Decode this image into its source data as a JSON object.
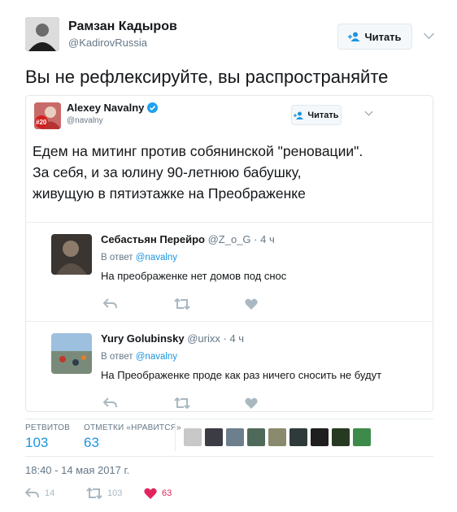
{
  "tweet": {
    "author_name": "Рамзан Кадыров",
    "author_handle": "@KadirovRussia",
    "follow_label": "Читать",
    "text": "Вы не рефлексируйте, вы распространяйте",
    "timestamp": "18:40 - 14 мая 2017 г."
  },
  "quoted": {
    "author_name": "Alexey Navalny",
    "verified_icon": "verified-badge-icon",
    "author_handle": "@navalny",
    "follow_label": "Читать",
    "badge": "#20",
    "text": "Едем на митинг против собянинской \"реновации\". За себя, и за юлину 90-летнюю бабушку, живущую в пятиэтажке на Преображенке"
  },
  "replies": [
    {
      "author_name": "Себастьян Перейро",
      "author_handle": "@Z_o_G",
      "time": "· 4 ч",
      "reply_prefix": "В ответ",
      "reply_to": "@navalny",
      "text": "На преображенке нет домов под снос"
    },
    {
      "author_name": "Yury Golubinsky",
      "author_handle": "@urixx",
      "time": "· 4 ч",
      "reply_prefix": "В ответ",
      "reply_to": "@navalny",
      "text": "На Преображенке проде как раз ничего сносить не будут"
    }
  ],
  "stats": {
    "retweets_label": "РЕТВИТОВ",
    "retweets_value": "103",
    "likes_label": "ОТМЕТКИ «НРАВИТСЯ»",
    "likes_value": "63"
  },
  "actions": {
    "reply_count": "14",
    "retweet_count": "103",
    "like_count": "63"
  },
  "colors": {
    "link": "#1b95e0",
    "like": "#e0245e",
    "icon": "#aab8c2"
  }
}
